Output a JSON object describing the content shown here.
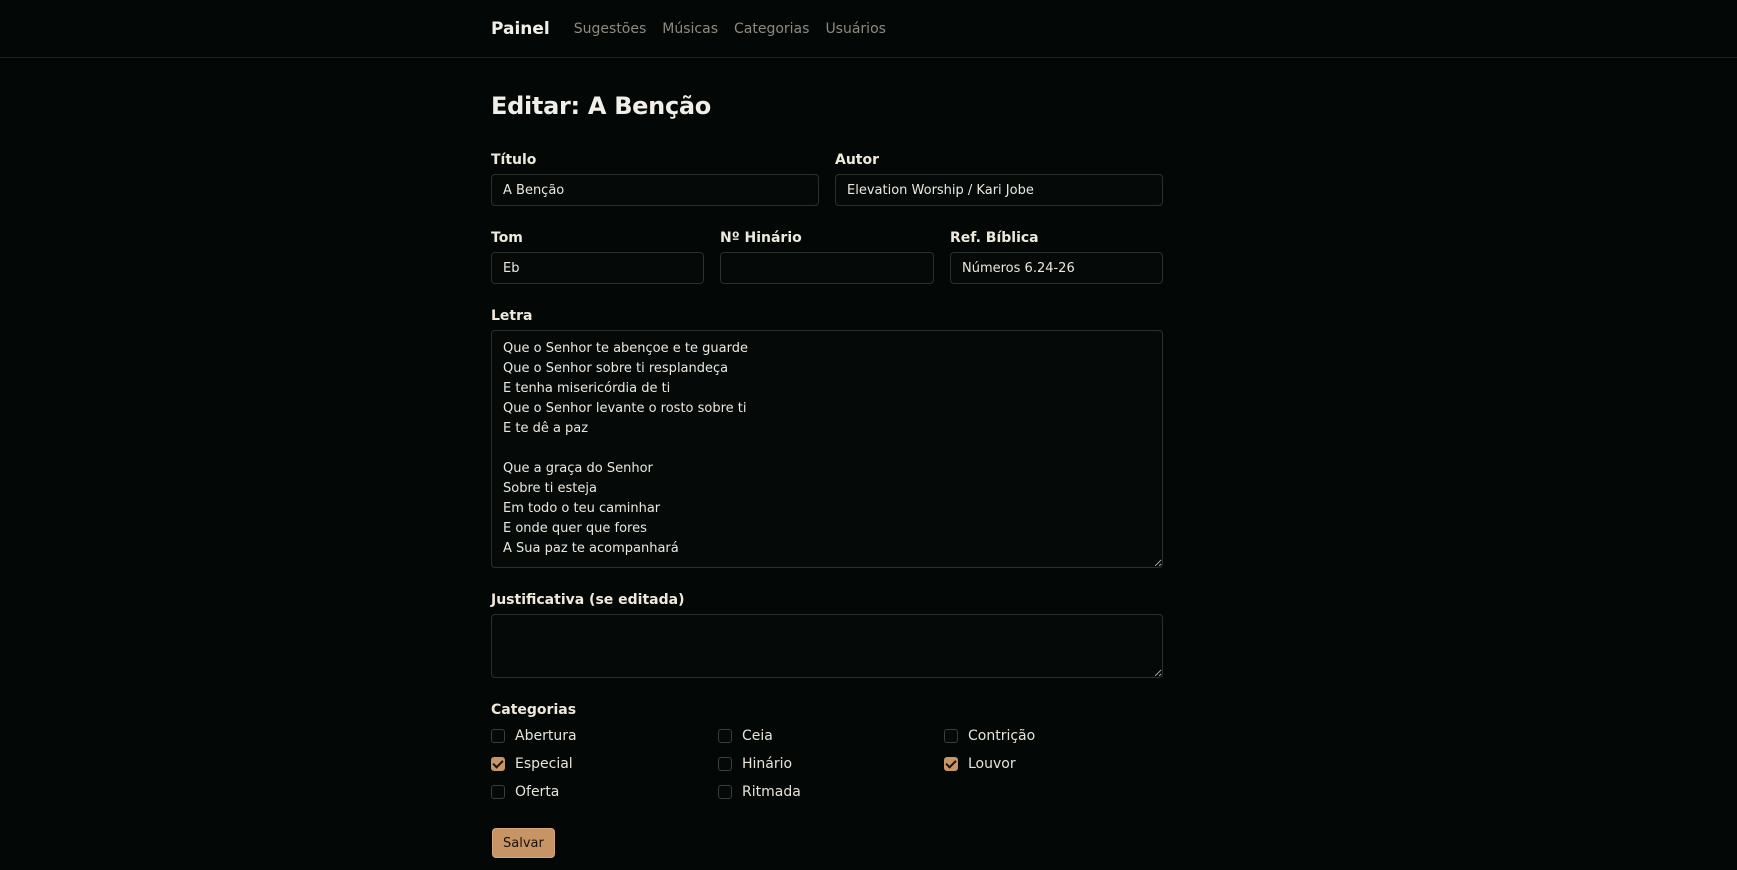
{
  "nav": {
    "brand": "Painel",
    "links": [
      "Sugestões",
      "Músicas",
      "Categorias",
      "Usuários"
    ]
  },
  "page": {
    "title": "Editar: A Benção"
  },
  "form": {
    "titulo": {
      "label": "Título",
      "value": "A Benção"
    },
    "autor": {
      "label": "Autor",
      "value": "Elevation Worship / Kari Jobe"
    },
    "tom": {
      "label": "Tom",
      "value": "Eb"
    },
    "hinario": {
      "label": "Nº Hinário",
      "value": ""
    },
    "ref": {
      "label": "Ref. Bíblica",
      "value": "Números 6.24-26"
    },
    "letra": {
      "label": "Letra",
      "value": "Que o Senhor te abençoe e te guarde\nQue o Senhor sobre ti resplandeça\nE tenha misericórdia de ti\nQue o Senhor levante o rosto sobre ti\nE te dê a paz\n\nQue a graça do Senhor\nSobre ti esteja\nEm todo o teu caminhar\nE onde quer que fores\nA Sua paz te acompanhará"
    },
    "justificativa": {
      "label": "Justificativa (se editada)",
      "value": ""
    },
    "categorias": {
      "label": "Categorias",
      "items": [
        {
          "label": "Abertura",
          "checked": false
        },
        {
          "label": "Ceia",
          "checked": false
        },
        {
          "label": "Contrição",
          "checked": false
        },
        {
          "label": "Especial",
          "checked": true
        },
        {
          "label": "Hinário",
          "checked": false
        },
        {
          "label": "Louvor",
          "checked": true
        },
        {
          "label": "Oferta",
          "checked": false
        },
        {
          "label": "Ritmada",
          "checked": false
        }
      ]
    },
    "save_label": "Salvar"
  }
}
